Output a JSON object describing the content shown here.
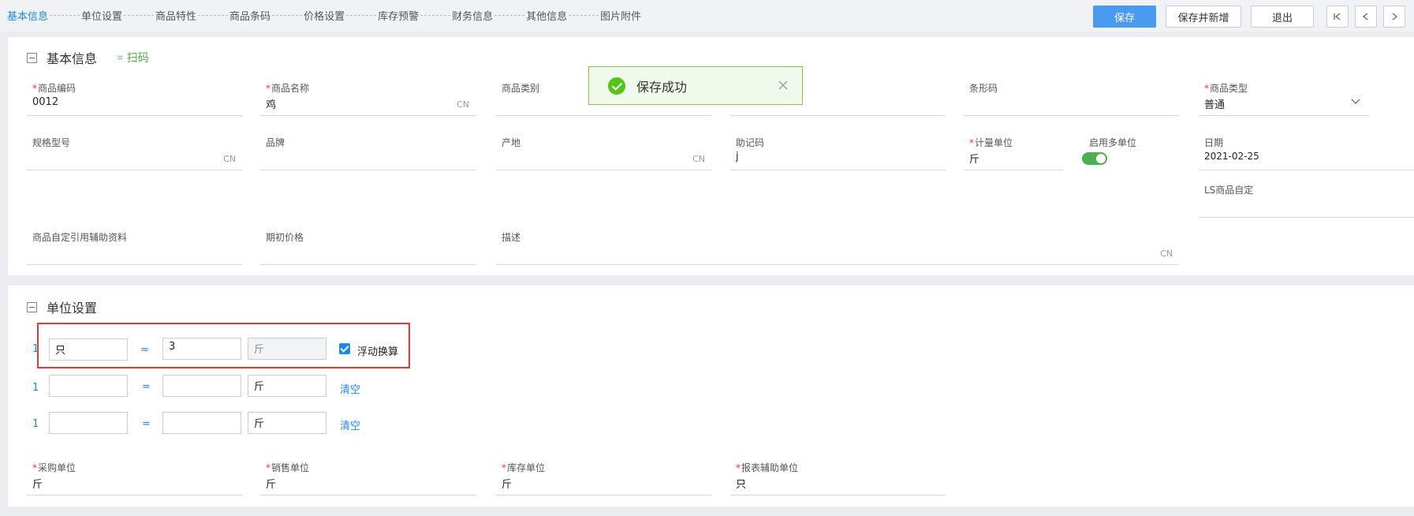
{
  "tabs": [
    "基本信息",
    "单位设置",
    "商品特性",
    "商品条码",
    "价格设置",
    "库存预警",
    "财务信息",
    "其他信息",
    "图片附件"
  ],
  "toolbar": {
    "save": "保存",
    "save_new": "保存并新增",
    "exit": "退出"
  },
  "nav": {
    "first": "|<",
    "prev": "<",
    "next": ">"
  },
  "basic": {
    "title": "基本信息",
    "scan": "扫码",
    "fields": {
      "code": {
        "label": "商品编码",
        "value": "0012"
      },
      "name": {
        "label": "商品名称",
        "value": "鸡",
        "suffix": "CN"
      },
      "category": {
        "label": "商品类别",
        "value": ""
      },
      "barcode": {
        "label": "条形码",
        "value": ""
      },
      "type": {
        "label": "商品类型",
        "value": "普通"
      },
      "spec": {
        "label": "规格型号",
        "value": "",
        "suffix": "CN"
      },
      "brand": {
        "label": "品牌",
        "value": ""
      },
      "origin": {
        "label": "产地",
        "value": "",
        "suffix": "CN"
      },
      "mnemonic": {
        "label": "助记码",
        "value": "j"
      },
      "unit": {
        "label": "计量单位",
        "value": "斤"
      },
      "multi_unit": {
        "label": "启用多单位"
      },
      "date": {
        "label": "日期",
        "value": "2021-02-25"
      },
      "ls_custom": {
        "label": "LS商品自定",
        "value": ""
      },
      "custom_ref": {
        "label": "商品自定引用辅助资料",
        "value": ""
      },
      "initial_price": {
        "label": "期初价格",
        "value": ""
      },
      "desc": {
        "label": "描述",
        "value": "",
        "suffix": "CN"
      }
    }
  },
  "units": {
    "title": "单位设置",
    "rows": [
      {
        "one": "1",
        "unit": "只",
        "op": "≈",
        "qty": "3",
        "base": "斤",
        "float_label": "浮动换算"
      },
      {
        "one": "1",
        "unit": "",
        "op": "=",
        "qty": "",
        "base": "斤",
        "clear": "清空"
      },
      {
        "one": "1",
        "unit": "",
        "op": "=",
        "qty": "",
        "base": "斤",
        "clear": "清空"
      }
    ],
    "purchase": {
      "label": "采购单位",
      "value": "斤"
    },
    "sales": {
      "label": "销售单位",
      "value": "斤"
    },
    "stock": {
      "label": "库存单位",
      "value": "斤"
    },
    "report": {
      "label": "报表辅助单位",
      "value": "只"
    }
  },
  "toast": {
    "text": "保存成功"
  }
}
